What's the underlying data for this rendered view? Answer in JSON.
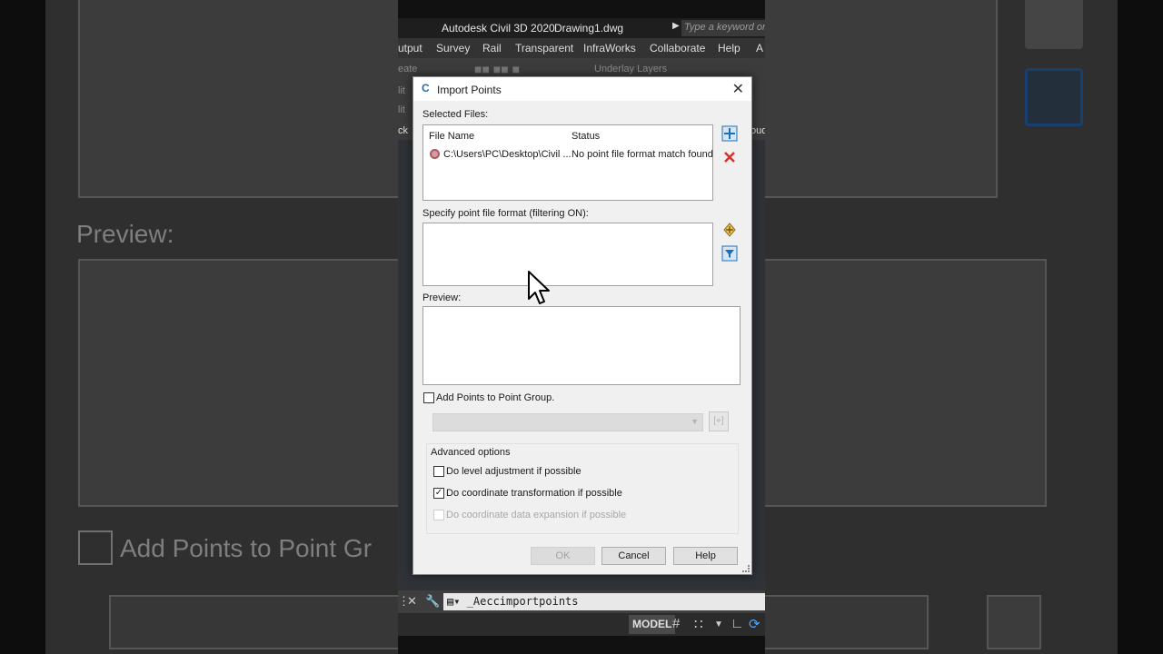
{
  "app": {
    "title": "Autodesk Civil 3D 2020",
    "document": "Drawing1.dwg",
    "search_placeholder": "Type a keyword or p"
  },
  "menu": [
    "utput",
    "Survey",
    "Rail",
    "Transparent",
    "InfraWorks",
    "Collaborate",
    "Help",
    "A"
  ],
  "ribbon": {
    "left_fragments": [
      "eate",
      "lit",
      "lit",
      "ck"
    ],
    "underlay_label": "Underlay Layers",
    "right_fragment": "oud"
  },
  "background": {
    "preview_label": "Preview:",
    "add_points_label": "Add Points to Point Gr"
  },
  "dialog": {
    "title": "Import Points",
    "selected_files_label": "Selected Files:",
    "columns": [
      "File Name",
      "Status"
    ],
    "files": [
      {
        "name": "C:\\Users\\PC\\Desktop\\Civil ...",
        "status": "No point file format match found"
      }
    ],
    "format_label": "Specify point file format (filtering ON):",
    "preview_label": "Preview:",
    "add_to_group_label": "Add Points to Point Group.",
    "add_to_group_checked": false,
    "advanced_label": "Advanced options",
    "options": [
      {
        "label": "Do level adjustment if possible",
        "checked": false,
        "enabled": true
      },
      {
        "label": "Do coordinate transformation if possible",
        "checked": true,
        "enabled": true
      },
      {
        "label": "Do coordinate data expansion if possible",
        "checked": false,
        "enabled": false
      }
    ],
    "buttons": {
      "ok": "OK",
      "cancel": "Cancel",
      "help": "Help"
    }
  },
  "command_line": {
    "text": "_Aeccimportpoints"
  },
  "status_bar": {
    "model": "MODEL"
  },
  "colors": {
    "accent": "#1c6fb8",
    "error": "#d9302c"
  }
}
